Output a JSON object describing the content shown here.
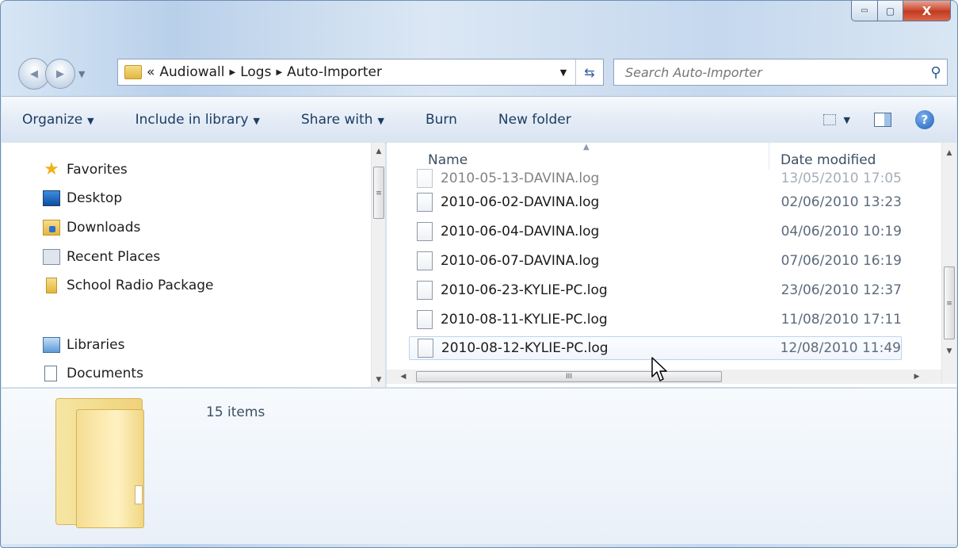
{
  "window": {
    "controls": {
      "minimize": "▭",
      "maximize": "▢",
      "close": "X"
    }
  },
  "nav": {
    "back_icon": "◀",
    "forward_icon": "▶",
    "history_icon": "▼"
  },
  "address": {
    "overflow": "«",
    "crumbs": [
      "Audiowall",
      "Logs",
      "Auto-Importer"
    ],
    "separator": "▶",
    "dropdown": "▼",
    "refresh": "⇆"
  },
  "search": {
    "placeholder": "Search Auto-Importer",
    "icon": "⚲"
  },
  "toolbar": {
    "organize": "Organize",
    "include": "Include in library",
    "share": "Share with",
    "burn": "Burn",
    "new_folder": "New folder",
    "arrow": "▼",
    "help": "?"
  },
  "sidebar": {
    "favorites": "Favorites",
    "desktop": "Desktop",
    "downloads": "Downloads",
    "recent": "Recent Places",
    "school": "School Radio Package",
    "libraries": "Libraries",
    "documents": "Documents"
  },
  "files": {
    "header_name": "Name",
    "header_date": "Date modified",
    "sort_icon": "▲",
    "clipped_row": {
      "name": "2010-05-13-DAVINA.log",
      "date": "13/05/2010 17:05"
    },
    "rows": [
      {
        "name": "2010-06-02-DAVINA.log",
        "date": "02/06/2010 13:23"
      },
      {
        "name": "2010-06-04-DAVINA.log",
        "date": "04/06/2010 10:19"
      },
      {
        "name": "2010-06-07-DAVINA.log",
        "date": "07/06/2010 16:19"
      },
      {
        "name": "2010-06-23-KYLIE-PC.log",
        "date": "23/06/2010 12:37"
      },
      {
        "name": "2010-08-11-KYLIE-PC.log",
        "date": "11/08/2010 17:11"
      },
      {
        "name": "2010-08-12-KYLIE-PC.log",
        "date": "12/08/2010 11:49"
      }
    ]
  },
  "scroll": {
    "up": "▲",
    "down": "▼",
    "left": "◀",
    "right": "▶",
    "grip": "≡",
    "hgrip": "III"
  },
  "details": {
    "count": "15 items"
  },
  "colors": {
    "accent": "#1d3d63",
    "chrome": "#c5d8ee",
    "hover_border": "#bcd3ee"
  }
}
